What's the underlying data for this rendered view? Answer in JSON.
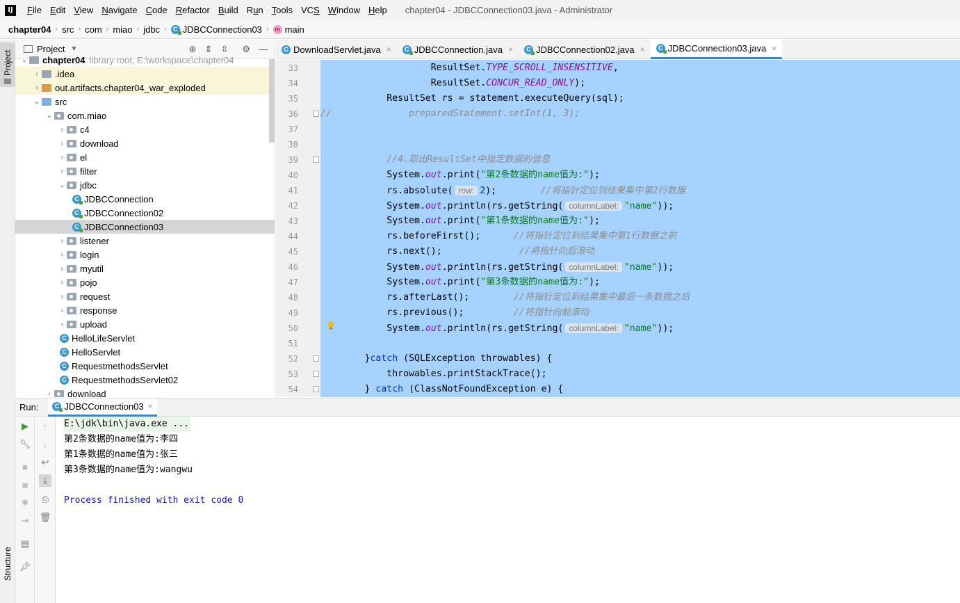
{
  "menu": {
    "logo": "IJ",
    "items": [
      "File",
      "Edit",
      "View",
      "Navigate",
      "Code",
      "Refactor",
      "Build",
      "Run",
      "Tools",
      "VCS",
      "Window",
      "Help"
    ],
    "mnemonics": [
      "F",
      "E",
      "V",
      "N",
      "C",
      "R",
      "B",
      "u",
      "T",
      "S",
      "W",
      "H"
    ]
  },
  "window_title": "chapter04 - JDBCConnection03.java - Administrator",
  "breadcrumb": [
    "chapter04",
    "src",
    "com",
    "miao",
    "jdbc",
    "JDBCConnection03",
    "main"
  ],
  "project_panel": {
    "title": "Project",
    "root": "chapter04",
    "root_hint": "library root,  E:\\workspace\\chapter04",
    "tree": [
      {
        "label": ".idea",
        "depth": 1,
        "expanded": false,
        "kind": "folder",
        "excluded": true
      },
      {
        "label": "out.artifacts.chapter04_war_exploded",
        "depth": 1,
        "expanded": false,
        "kind": "folder-orange",
        "excluded": true
      },
      {
        "label": "src",
        "depth": 1,
        "expanded": true,
        "kind": "folder-blue"
      },
      {
        "label": "com.miao",
        "depth": 2,
        "expanded": true,
        "kind": "package"
      },
      {
        "label": "c4",
        "depth": 3,
        "expanded": false,
        "kind": "package"
      },
      {
        "label": "download",
        "depth": 3,
        "expanded": false,
        "kind": "package"
      },
      {
        "label": "el",
        "depth": 3,
        "expanded": false,
        "kind": "package"
      },
      {
        "label": "filter",
        "depth": 3,
        "expanded": false,
        "kind": "package"
      },
      {
        "label": "jdbc",
        "depth": 3,
        "expanded": true,
        "kind": "package"
      },
      {
        "label": "JDBCConnection",
        "depth": 4,
        "kind": "class-run"
      },
      {
        "label": "JDBCConnection02",
        "depth": 4,
        "kind": "class-run"
      },
      {
        "label": "JDBCConnection03",
        "depth": 4,
        "kind": "class-run",
        "selected": true
      },
      {
        "label": "listener",
        "depth": 3,
        "expanded": false,
        "kind": "package"
      },
      {
        "label": "login",
        "depth": 3,
        "expanded": false,
        "kind": "package"
      },
      {
        "label": "myutil",
        "depth": 3,
        "expanded": false,
        "kind": "package"
      },
      {
        "label": "pojo",
        "depth": 3,
        "expanded": false,
        "kind": "package"
      },
      {
        "label": "request",
        "depth": 3,
        "expanded": false,
        "kind": "package"
      },
      {
        "label": "response",
        "depth": 3,
        "expanded": false,
        "kind": "package"
      },
      {
        "label": "upload",
        "depth": 3,
        "expanded": false,
        "kind": "package"
      },
      {
        "label": "HelloLifeServlet",
        "depth": 3,
        "kind": "class"
      },
      {
        "label": "HelloServlet",
        "depth": 3,
        "kind": "class"
      },
      {
        "label": "RequestmethodsServlet",
        "depth": 3,
        "kind": "class"
      },
      {
        "label": "RequestmethodsServlet02",
        "depth": 3,
        "kind": "class"
      },
      {
        "label": "download",
        "depth": 2,
        "expanded": false,
        "kind": "package"
      }
    ]
  },
  "editor_tabs": [
    {
      "label": "DownloadServlet.java",
      "active": false,
      "run": false
    },
    {
      "label": "JDBCConnection.java",
      "active": false,
      "run": true
    },
    {
      "label": "JDBCConnection02.java",
      "active": false,
      "run": true
    },
    {
      "label": "JDBCConnection03.java",
      "active": true,
      "run": true
    }
  ],
  "code_lines": [
    {
      "n": "33",
      "indent": "                    ",
      "parts": [
        [
          "t",
          "ResultSet."
        ],
        [
          "f",
          "TYPE_SCROLL_INSENSITIVE"
        ],
        [
          "t",
          ","
        ]
      ]
    },
    {
      "n": "34",
      "indent": "                    ",
      "parts": [
        [
          "t",
          "ResultSet."
        ],
        [
          "f",
          "CONCUR_READ_ONLY"
        ],
        [
          "t",
          ");"
        ]
      ]
    },
    {
      "n": "35",
      "indent": "            ",
      "parts": [
        [
          "t",
          "ResultSet rs = statement.executeQuery(sql);"
        ]
      ]
    },
    {
      "n": "36",
      "indent": "",
      "parts": [
        [
          "c",
          "//"
        ],
        [
          "c",
          "              preparedStatement.setInt(1, 3);"
        ]
      ]
    },
    {
      "n": "37",
      "indent": "",
      "parts": []
    },
    {
      "n": "38",
      "indent": "",
      "parts": []
    },
    {
      "n": "39",
      "indent": "            ",
      "parts": [
        [
          "c",
          "//4.取出ResultSet中指定数据的信息"
        ]
      ]
    },
    {
      "n": "40",
      "indent": "            ",
      "parts": [
        [
          "t",
          "System."
        ],
        [
          "f",
          "out"
        ],
        [
          "t",
          ".print("
        ],
        [
          "s",
          "\"第2条数据的name值为:\""
        ],
        [
          "t",
          ");"
        ]
      ]
    },
    {
      "n": "41",
      "indent": "            ",
      "parts": [
        [
          "t",
          "rs.absolute("
        ],
        [
          "h",
          "row:"
        ],
        [
          "k",
          "2"
        ],
        [
          "t",
          ");        "
        ],
        [
          "c",
          "//将指针定位到结果集中第2行数据"
        ]
      ]
    },
    {
      "n": "42",
      "indent": "            ",
      "parts": [
        [
          "t",
          "System."
        ],
        [
          "f",
          "out"
        ],
        [
          "t",
          ".println(rs.getString("
        ],
        [
          "h",
          "columnLabel:"
        ],
        [
          "s",
          "\"name\""
        ],
        [
          "t",
          "));"
        ]
      ]
    },
    {
      "n": "43",
      "indent": "            ",
      "parts": [
        [
          "t",
          "System."
        ],
        [
          "f",
          "out"
        ],
        [
          "t",
          ".print("
        ],
        [
          "s",
          "\"第1条数据的name值为:\""
        ],
        [
          "t",
          ");"
        ]
      ]
    },
    {
      "n": "44",
      "indent": "            ",
      "parts": [
        [
          "t",
          "rs.beforeFirst();      "
        ],
        [
          "c",
          "//将指针定位到结果集中第1行数据之前"
        ]
      ]
    },
    {
      "n": "45",
      "indent": "            ",
      "parts": [
        [
          "t",
          "rs.next();              "
        ],
        [
          "c",
          "//将指针向后滚动"
        ]
      ]
    },
    {
      "n": "46",
      "indent": "            ",
      "parts": [
        [
          "t",
          "System."
        ],
        [
          "f",
          "out"
        ],
        [
          "t",
          ".println(rs.getString("
        ],
        [
          "h",
          "columnLabel:"
        ],
        [
          "s",
          "\"name\""
        ],
        [
          "t",
          "));"
        ]
      ]
    },
    {
      "n": "47",
      "indent": "            ",
      "parts": [
        [
          "t",
          "System."
        ],
        [
          "f",
          "out"
        ],
        [
          "t",
          ".print("
        ],
        [
          "s",
          "\"第3条数据的name值为:\""
        ],
        [
          "t",
          ");"
        ]
      ]
    },
    {
      "n": "48",
      "indent": "            ",
      "parts": [
        [
          "t",
          "rs.afterLast();        "
        ],
        [
          "c",
          "//将指针定位到结果集中最后一条数据之后"
        ]
      ]
    },
    {
      "n": "49",
      "indent": "            ",
      "parts": [
        [
          "t",
          "rs.previous();         "
        ],
        [
          "c",
          "//将指针向前滚动"
        ]
      ]
    },
    {
      "n": "50",
      "indent": "            ",
      "parts": [
        [
          "t",
          "System."
        ],
        [
          "f",
          "out"
        ],
        [
          "t",
          ".println(rs.getString("
        ],
        [
          "h",
          "columnLabel:"
        ],
        [
          "s",
          "\"name\""
        ],
        [
          "t",
          "));"
        ]
      ]
    },
    {
      "n": "51",
      "indent": "",
      "parts": []
    },
    {
      "n": "52",
      "indent": "        ",
      "parts": [
        [
          "t",
          "}"
        ],
        [
          "k",
          "catch"
        ],
        [
          "t",
          " (SQLException throwables) {"
        ]
      ]
    },
    {
      "n": "53",
      "indent": "            ",
      "parts": [
        [
          "t",
          "throwables.printStackTrace();"
        ]
      ]
    },
    {
      "n": "54",
      "indent": "        ",
      "parts": [
        [
          "t",
          "} "
        ],
        [
          "k",
          "catch"
        ],
        [
          "t",
          " (ClassNotFoundException e) {"
        ]
      ]
    }
  ],
  "run_panel": {
    "label": "Run:",
    "tab": "JDBCConnection03",
    "console": [
      {
        "text": "E:\\jdk\\bin\\java.exe ...",
        "kind": "cmd"
      },
      {
        "text": "第2条数据的name值为:李四",
        "kind": "out"
      },
      {
        "text": "第1条数据的name值为:张三",
        "kind": "out"
      },
      {
        "text": "第3条数据的name值为:wangwu",
        "kind": "out"
      },
      {
        "text": "",
        "kind": "out"
      },
      {
        "text": "Process finished with exit code 0",
        "kind": "proc"
      }
    ]
  },
  "side_strip": {
    "project": "Project",
    "structure": "Structure"
  },
  "colors": {
    "selection": "#a6d2ff",
    "keyword": "#0033b3",
    "field": "#871094",
    "string": "#067d17",
    "comment": "#8c8c8c",
    "accent": "#4083c9"
  }
}
